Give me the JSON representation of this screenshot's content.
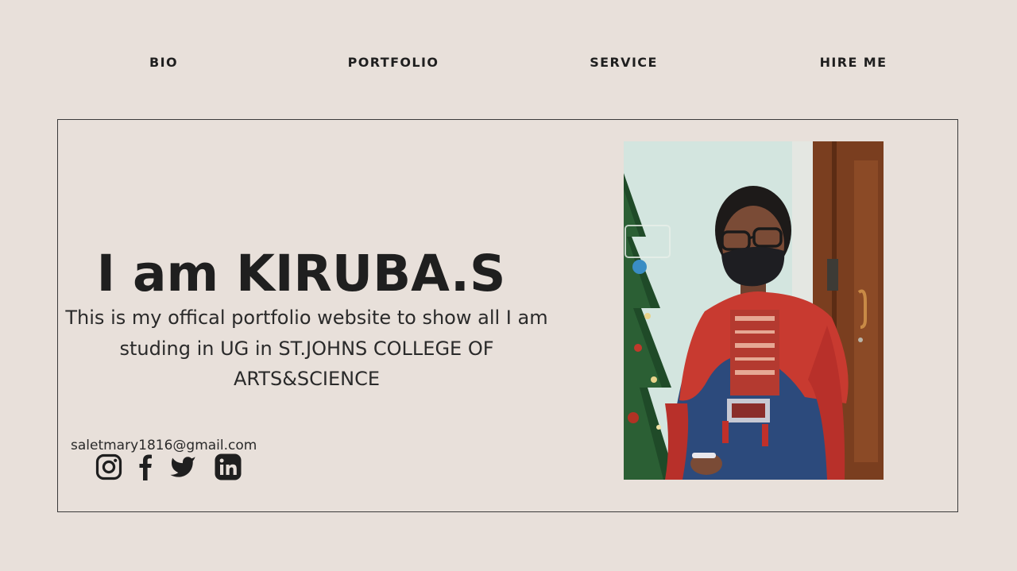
{
  "nav": {
    "items": [
      {
        "label": "BIO"
      },
      {
        "label": "PORTFOLIO"
      },
      {
        "label": "SERVICE"
      },
      {
        "label": "HIRE ME"
      }
    ]
  },
  "hero": {
    "title": "I am KIRUBA.S",
    "description": "This is my offical portfolio website to show all I am studing in UG in ST.JOHNS COLLEGE OF ARTS&SCIENCE",
    "email": "saletmary1816@gmail.com"
  },
  "social": {
    "icons": [
      "instagram-icon",
      "facebook-icon",
      "twitter-icon",
      "linkedin-icon"
    ]
  },
  "colors": {
    "background": "#e8e0da",
    "text": "#1f1f1f",
    "border": "#3a3a3a"
  }
}
